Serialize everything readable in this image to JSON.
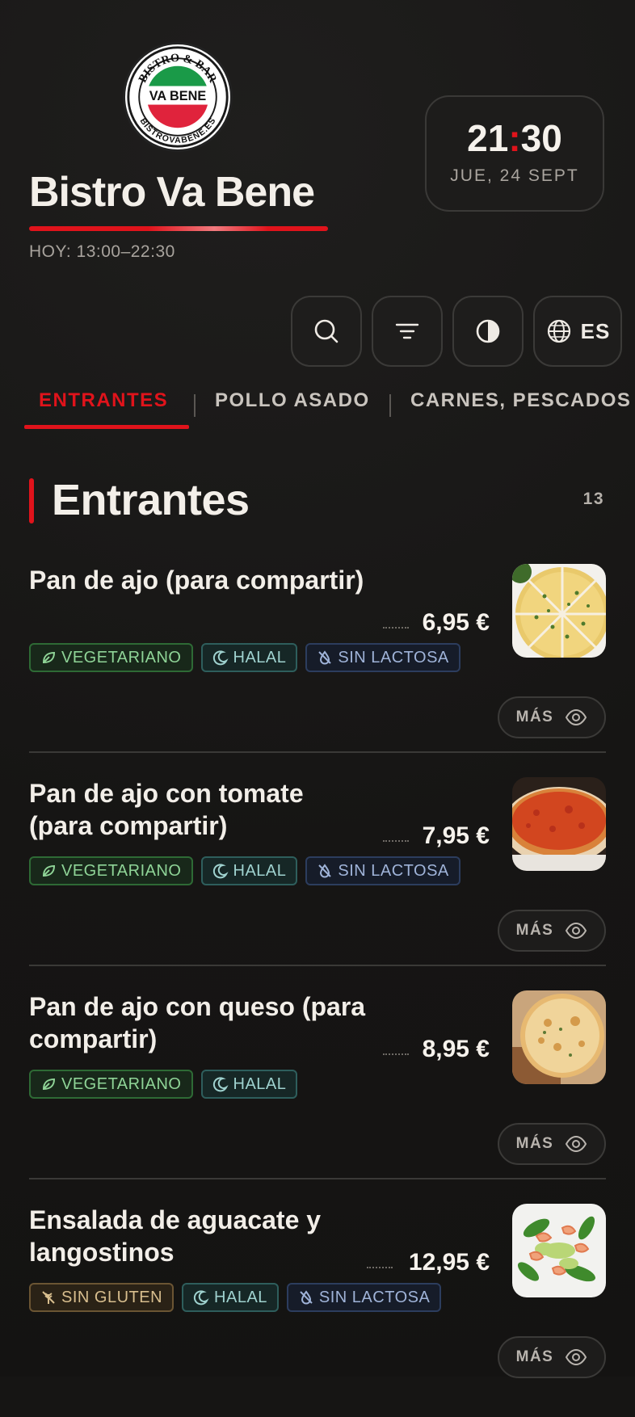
{
  "header": {
    "logo": {
      "ring_top": "BISTRO & BAR",
      "center": "VA BENE",
      "ring_bottom": "BISTROVABENE.ES"
    },
    "title": "Bistro Va Bene",
    "hours": "HOY: 13:00–22:30"
  },
  "clock": {
    "hours": "21",
    "colon": ":",
    "minutes": "30",
    "date": "JUE, 24 SEPT"
  },
  "toolbar": {
    "search_icon": "search-icon",
    "filter_icon": "filter-icon",
    "theme_icon": "contrast-icon",
    "language_icon": "globe-icon",
    "language": "ES"
  },
  "tabs": [
    {
      "label": "ENTRANTES",
      "active": true
    },
    {
      "label": "POLLO ASADO",
      "active": false
    },
    {
      "label": "CARNES, PESCADOS",
      "active": false
    }
  ],
  "section": {
    "title": "Entrantes",
    "count": "13"
  },
  "items": [
    {
      "name": "Pan de ajo (para compartir)",
      "price": "6,95 €",
      "tags": [
        {
          "label": "VEGETARIANO",
          "kind": "veg"
        },
        {
          "label": "HALAL",
          "kind": "halal"
        },
        {
          "label": "SIN LACTOSA",
          "kind": "lact"
        }
      ],
      "more_label": "MÁS"
    },
    {
      "name": "Pan de ajo con tomate (para compartir)",
      "price": "7,95 €",
      "tags": [
        {
          "label": "VEGETARIANO",
          "kind": "veg"
        },
        {
          "label": "HALAL",
          "kind": "halal"
        },
        {
          "label": "SIN LACTOSA",
          "kind": "lact"
        }
      ],
      "more_label": "MÁS"
    },
    {
      "name": "Pan de ajo con queso (para compartir)",
      "price": "8,95 €",
      "tags": [
        {
          "label": "VEGETARIANO",
          "kind": "veg"
        },
        {
          "label": "HALAL",
          "kind": "halal"
        }
      ],
      "more_label": "MÁS"
    },
    {
      "name": "Ensalada de aguacate y langostinos",
      "price": "12,95 €",
      "tags": [
        {
          "label": "SIN GLUTEN",
          "kind": "glut"
        },
        {
          "label": "HALAL",
          "kind": "halal"
        },
        {
          "label": "SIN LACTOSA",
          "kind": "lact"
        }
      ],
      "more_label": "MÁS"
    }
  ],
  "colors": {
    "accent": "#e0131b",
    "background": "#161514",
    "text": "#f1eeea"
  }
}
